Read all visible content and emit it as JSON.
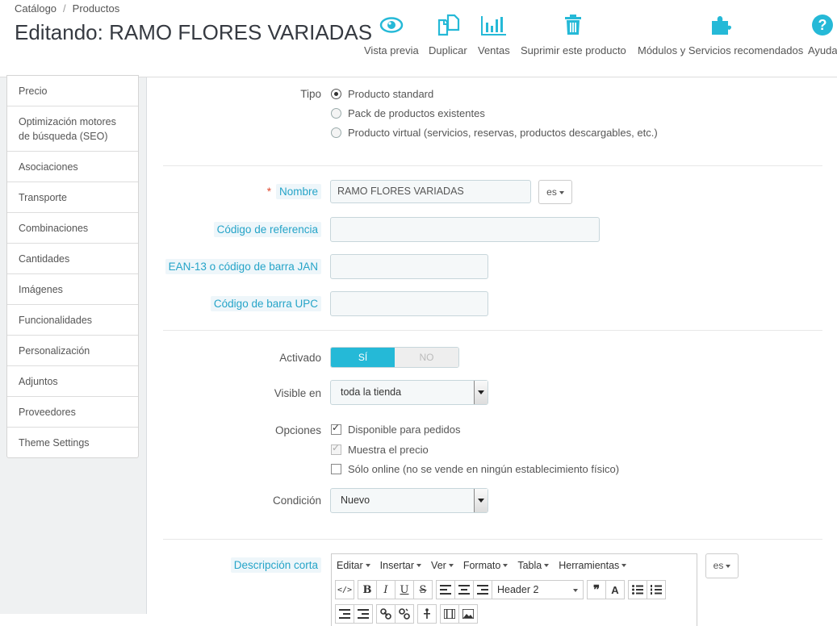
{
  "breadcrumb": {
    "item1": "Catálogo",
    "separator": "/",
    "item2": "Productos"
  },
  "page_title": "Editando: RAMO FLORES VARIADAS",
  "toolbar": {
    "preview": "Vista previa",
    "duplicate": "Duplicar",
    "sales": "Ventas",
    "delete": "Suprimir este producto",
    "modules": "Módulos y Servicios recomendados",
    "help": "Ayuda"
  },
  "colors": {
    "accent": "#25b9d7",
    "hint_bg": "#eef6fa",
    "hint_text": "#25a4c8"
  },
  "sidebar": {
    "items": [
      {
        "label": "Precio"
      },
      {
        "label": "Optimización motores de búsqueda (SEO)"
      },
      {
        "label": "Asociaciones"
      },
      {
        "label": "Transporte"
      },
      {
        "label": "Combinaciones"
      },
      {
        "label": "Cantidades"
      },
      {
        "label": "Imágenes"
      },
      {
        "label": "Funcionalidades"
      },
      {
        "label": "Personalización"
      },
      {
        "label": "Adjuntos"
      },
      {
        "label": "Proveedores"
      },
      {
        "label": "Theme Settings"
      }
    ]
  },
  "form": {
    "type": {
      "label": "Tipo",
      "options": [
        {
          "label": "Producto standard",
          "checked": true
        },
        {
          "label": "Pack de productos existentes",
          "checked": false
        },
        {
          "label": "Producto virtual (servicios, reservas, productos descargables, etc.)",
          "checked": false
        }
      ]
    },
    "name": {
      "required": "*",
      "label": "Nombre",
      "value": "RAMO FLORES VARIADAS",
      "lang": "es"
    },
    "reference": {
      "label": "Código de referencia",
      "value": ""
    },
    "ean13": {
      "label": "EAN-13 o código de barra JAN",
      "value": ""
    },
    "upc": {
      "label": "Código de barra UPC",
      "value": ""
    },
    "active": {
      "label": "Activado",
      "yes": "SÍ",
      "no": "NO",
      "value": "yes"
    },
    "visibility": {
      "label": "Visible en",
      "value": "toda la tienda"
    },
    "options": {
      "label": "Opciones",
      "items": [
        {
          "label": "Disponible para pedidos",
          "checked": true,
          "disabled": false
        },
        {
          "label": "Muestra el precio",
          "checked": true,
          "disabled": true
        },
        {
          "label": "Sólo online (no se vende en ningún establecimiento físico)",
          "checked": false,
          "disabled": false
        }
      ]
    },
    "condition": {
      "label": "Condición",
      "value": "Nuevo"
    },
    "short_description": {
      "label": "Descripción corta",
      "lang": "es",
      "menus": [
        "Editar",
        "Insertar",
        "Ver",
        "Formato",
        "Tabla",
        "Herramientas"
      ],
      "format_select": "Header 2"
    }
  }
}
